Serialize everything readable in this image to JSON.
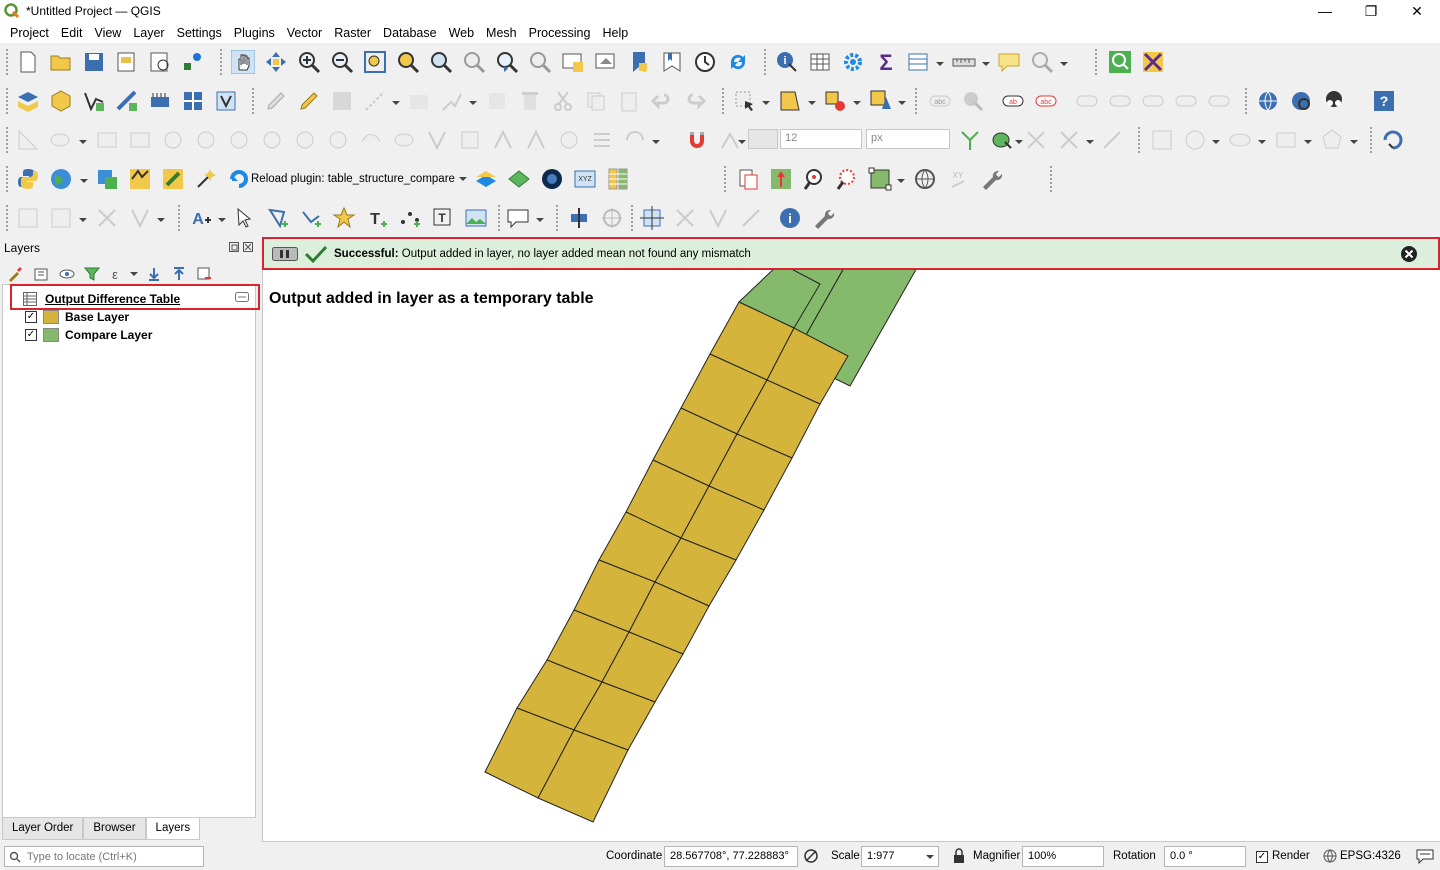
{
  "window": {
    "title": "*Untitled Project — QGIS"
  },
  "menu": [
    "Project",
    "Edit",
    "View",
    "Layer",
    "Settings",
    "Plugins",
    "Vector",
    "Raster",
    "Database",
    "Web",
    "Mesh",
    "Processing",
    "Help"
  ],
  "toolbar": {
    "reload_plugin_label": "Reload plugin: table_structure_compare",
    "size_value": "12",
    "unit_value": "px"
  },
  "layers_panel": {
    "title": "Layers",
    "items": [
      {
        "label": "Output Difference Table",
        "type": "table"
      },
      {
        "label": "Base Layer",
        "checked": true,
        "color": "#d4b43a"
      },
      {
        "label": "Compare Layer",
        "checked": true,
        "color": "#85b96b"
      }
    ],
    "tabs": [
      "Layer Order",
      "Browser",
      "Layers"
    ]
  },
  "message_bar": {
    "title": "Successful:",
    "text": "Output added in layer, no layer added mean not found any mismatch"
  },
  "annotation": "Output added in layer as a temporary table",
  "status": {
    "locate_placeholder": "Type to locate (Ctrl+K)",
    "coordinate_label": "Coordinate",
    "coordinate_value": "28.567708°, 77.228883°",
    "scale_label": "Scale",
    "scale_value": "1:977",
    "magnifier_label": "Magnifier",
    "magnifier_value": "100%",
    "rotation_label": "Rotation",
    "rotation_value": "0.0 °",
    "render_label": "Render",
    "crs": "EPSG:4326"
  },
  "colors": {
    "base": "#d4b43a",
    "compare": "#85b96b",
    "success_bg": "#dcefdc",
    "highlight": "#d9232f"
  }
}
